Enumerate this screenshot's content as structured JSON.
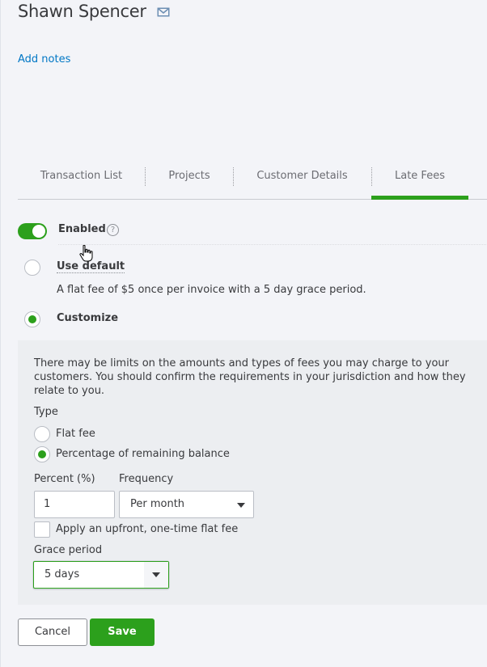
{
  "header": {
    "customer_name": "Shawn Spencer",
    "email_icon": "envelope-icon",
    "add_notes_label": "Add notes"
  },
  "tabs": [
    {
      "label": "Transaction List",
      "active": false
    },
    {
      "label": "Projects",
      "active": false
    },
    {
      "label": "Customer Details",
      "active": false
    },
    {
      "label": "Late Fees",
      "active": true
    }
  ],
  "late_fees": {
    "enabled": true,
    "enabled_label": "Enabled",
    "help_icon": "?",
    "use_default_label": "Use default",
    "use_default_description": "A flat fee of $5 once per invoice with a 5 day grace period.",
    "customize_label": "Customize",
    "selected_option": "Customize",
    "customize_panel": {
      "notice": "There may be limits on the amounts and types of fees you may charge to your customers. You should confirm the requirements in your jurisdiction and how they relate to you.",
      "type_label": "Type",
      "type_options": [
        "Flat fee",
        "Percentage of remaining balance"
      ],
      "type_selected": "Percentage of remaining balance",
      "percent_label": "Percent (%)",
      "percent_value": "1",
      "frequency_label": "Frequency",
      "frequency_value": "Per month",
      "upfront_fee_label": "Apply an upfront, one-time flat fee",
      "upfront_fee_checked": false,
      "grace_period_label": "Grace period",
      "grace_period_value": "5 days"
    }
  },
  "actions": {
    "cancel_label": "Cancel",
    "save_label": "Save"
  },
  "colors": {
    "accent_green": "#2ca01c",
    "link_blue": "#0077c5"
  }
}
